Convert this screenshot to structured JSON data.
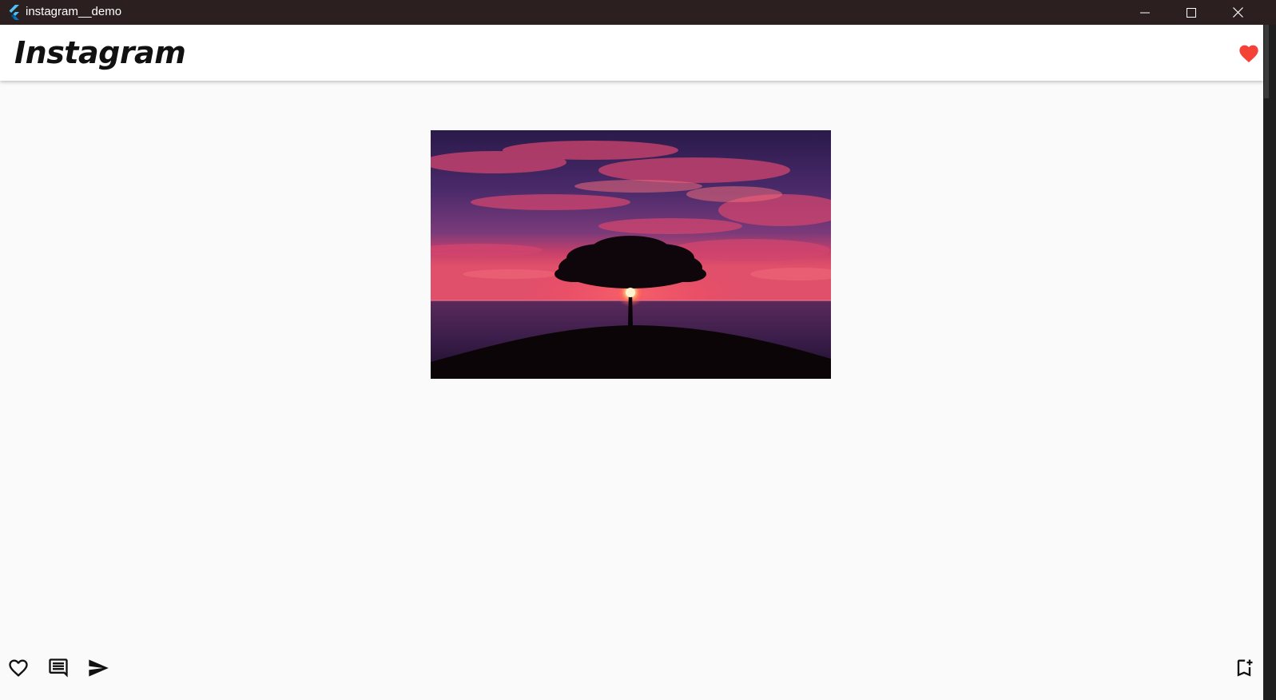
{
  "window": {
    "title": "instagram__demo"
  },
  "appbar": {
    "title": "Instagram",
    "action_icon": "heart-filled-icon",
    "accent_color": "#f44336"
  },
  "post": {
    "image_icon": "sunset-tree-photo",
    "actions": [
      {
        "icon": "heart-outline-icon"
      },
      {
        "icon": "comment-icon"
      },
      {
        "icon": "send-icon"
      },
      {
        "icon": "bookmark-add-icon"
      }
    ]
  },
  "colors": {
    "titlebar_bg": "#2b1f1f",
    "page_bg": "#fafafa",
    "appbar_bg": "#ffffff"
  }
}
